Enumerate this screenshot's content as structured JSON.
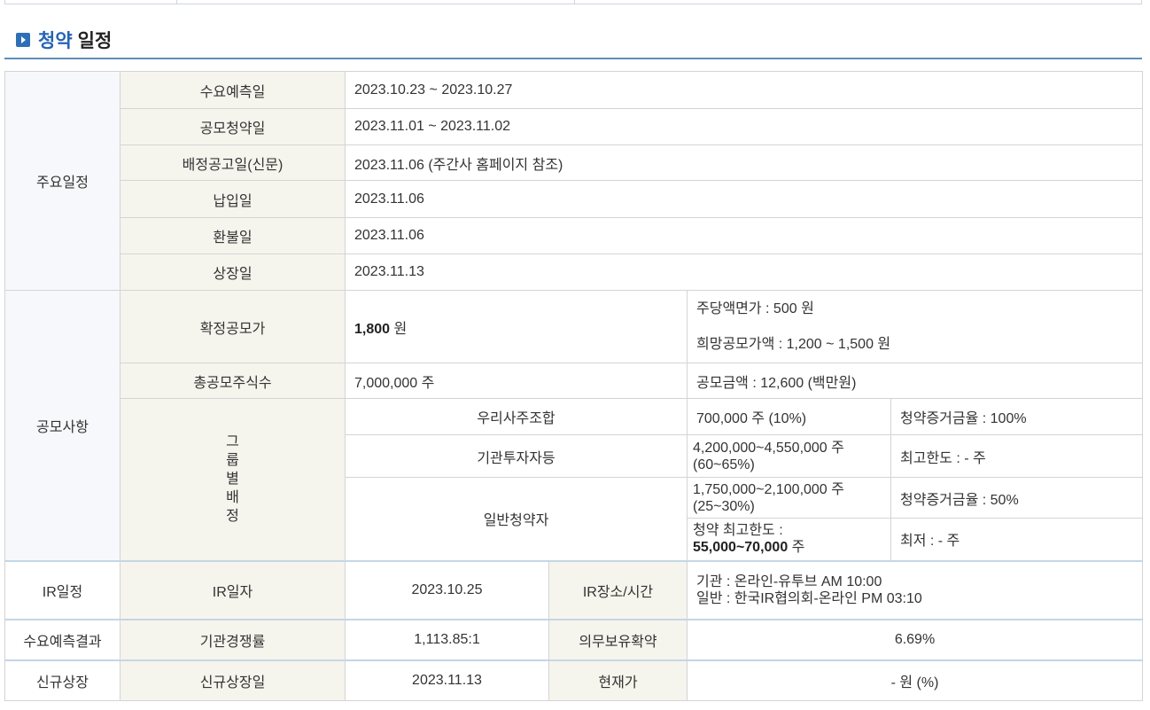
{
  "section": {
    "title_accent": "청약",
    "title_rest": "일정"
  },
  "schedule": {
    "category": "주요일정",
    "rows": [
      {
        "label": "수요예측일",
        "value": "2023.10.23  ~  2023.10.27"
      },
      {
        "label": "공모청약일",
        "value": "2023.11.01  ~  2023.11.02"
      },
      {
        "label": "배정공고일(신문)",
        "value": "2023.11.06 (주간사 홈페이지 참조)"
      },
      {
        "label": "납입일",
        "value": "2023.11.06"
      },
      {
        "label": "환불일",
        "value": "2023.11.06"
      },
      {
        "label": "상장일",
        "value": "2023.11.13"
      }
    ]
  },
  "offering": {
    "category": "공모사항",
    "price_label": "확정공모가",
    "price_value": "1,800",
    "price_unit": " 원",
    "par_value": "주당액면가 :  500 원",
    "hope_price": "희망공모가액 :  1,200 ~ 1,500 원",
    "shares_label": "총공모주식수",
    "shares_value": "7,000,000 주",
    "amount": "공모금액 : 12,600 (백만원)",
    "group_label": [
      "그",
      "룹",
      "별",
      "배",
      "정"
    ],
    "groups": [
      {
        "name": "우리사주조합",
        "shares": "700,000 주  (10%)",
        "note": "청약증거금율 : 100%"
      },
      {
        "name": "기관투자자등",
        "shares_line1": " 4,200,000~4,550,000 주",
        "shares_line2": "(60~65%)",
        "note": "최고한도 :  - 주"
      },
      {
        "name": "일반청약자",
        "shares_line1": " 1,750,000~2,100,000 주",
        "shares_line2": "(25~30%)",
        "note": "청약증거금율 : 50%",
        "limit_label": "청약 최고한도 :",
        "limit_value": "55,000~70,000",
        "limit_unit": " 주",
        "min_note": "최저 :  - 주"
      }
    ]
  },
  "ir": {
    "category": "IR일정",
    "date_label": "IR일자",
    "date_value": "2023.10.25",
    "place_label": "IR장소/시간",
    "place_line1": "기관 : 온라인-유투브 AM 10:00",
    "place_line2": "일반 : 한국IR협의회-온라인 PM 03:10"
  },
  "demand": {
    "category": "수요예측결과",
    "comp_label": "기관경쟁률",
    "comp_value": "1,113.85:1",
    "lock_label": "의무보유확약",
    "lock_value": "6.69%"
  },
  "listing": {
    "category": "신규상장",
    "date_label": "신규상장일",
    "date_value": "2023.11.13",
    "price_label": "현재가",
    "price_value": "- 원 (%)"
  }
}
